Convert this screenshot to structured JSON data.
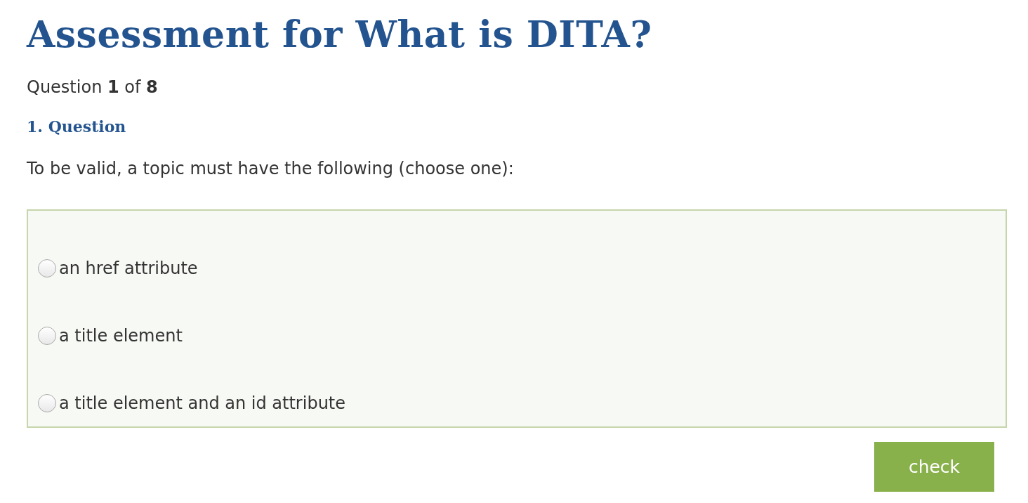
{
  "title": "Assessment for What is DITA?",
  "progress": "Question **1** of **8**",
  "question": {
    "heading": "1. Question",
    "text": "To be valid, a topic must have the following (choose one):",
    "options": [
      {
        "label": "an href attribute",
        "selected": false
      },
      {
        "label": "a title element",
        "selected": false
      },
      {
        "label": "a title element and an id attribute",
        "selected": false
      }
    ]
  },
  "button": {
    "label": "check"
  }
}
